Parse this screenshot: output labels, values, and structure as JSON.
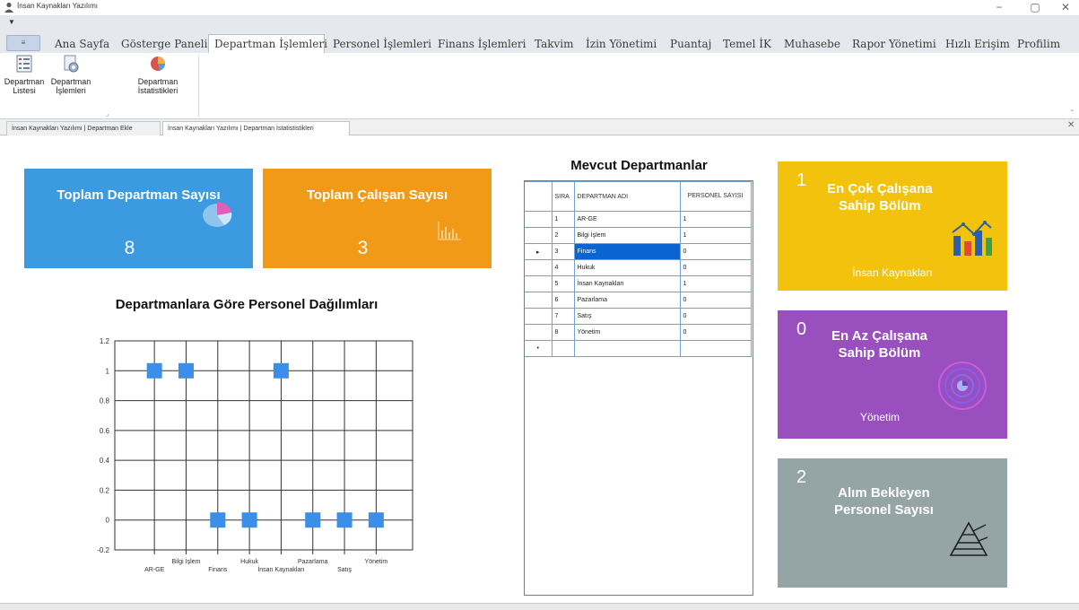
{
  "window": {
    "title": "İnsan Kaynakları Yazılımı",
    "minimize": "−",
    "maximize": "▢",
    "close": "✕"
  },
  "ribbon": {
    "app_button": "≡",
    "tabs": [
      "Ana Sayfa",
      "Gösterge Paneli",
      "Departman İşlemleri",
      "Personel İşlemleri",
      "Finans İşlemleri",
      "Takvim",
      "İzin Yönetimi",
      "Puantaj",
      "Temel İK",
      "Muhasebe",
      "Rapor Yönetimi",
      "Hızlı Erişim",
      "Profilim"
    ],
    "active_tab": "Departman İşlemleri",
    "buttons": [
      {
        "line1": "Departman",
        "line2": "Listesi",
        "icon": "list-icon"
      },
      {
        "line1": "Departman",
        "line2": "İşlemleri",
        "icon": "settings-doc-icon"
      },
      {
        "line1": "Departman",
        "line2": "İstatistikleri",
        "icon": "pie-chart-icon"
      }
    ]
  },
  "doc_tabs": [
    "İnsan Kaynakları Yazılımı | Departman Ekle",
    "İnsan Kaynakları Yazılımı | Departman İstatististikleri"
  ],
  "cards": {
    "dept_count": {
      "title": "Toplam Departman Sayısı",
      "value": "8",
      "color": "#3b9ae0",
      "icon": "pie-chart-icon"
    },
    "emp_count": {
      "title": "Toplam Çalışan Sayısı",
      "value": "3",
      "color": "#f19a18",
      "icon": "bar-chart-icon"
    }
  },
  "chart_title": "Departmanlara Göre Personel Dağılımları",
  "chart_data": {
    "type": "scatter",
    "title": "Departmanlara Göre Personel Dağılımları",
    "categories": [
      "AR-GE",
      "Bilgi İşlem",
      "Finans",
      "Hukuk",
      "İnsan Kaynakları",
      "Pazarlama",
      "Satış",
      "Yönetim"
    ],
    "values": [
      1,
      1,
      0,
      0,
      1,
      0,
      0,
      0
    ],
    "ylim": [
      -0.2,
      1.2
    ],
    "yticks": [
      "1.2",
      "1",
      "0.8",
      "0.6",
      "0.4",
      "0.2",
      "0",
      "-0.2"
    ],
    "grid": true,
    "marker_color": "#3b8fe8"
  },
  "grid": {
    "title": "Mevcut Departmanlar",
    "headers": {
      "sira": "SIRA",
      "name": "DEPARTMAN ADI",
      "count": "PERSONEL SAYISI"
    },
    "rows": [
      {
        "sira": "1",
        "name": "AR-GE",
        "count": "1"
      },
      {
        "sira": "2",
        "name": "Bilgi İşlem",
        "count": "1"
      },
      {
        "sira": "3",
        "name": "Finans",
        "count": "0"
      },
      {
        "sira": "4",
        "name": "Hukuk",
        "count": "0"
      },
      {
        "sira": "5",
        "name": "İnsan Kaynakları",
        "count": "1"
      },
      {
        "sira": "6",
        "name": "Pazarlama",
        "count": "0"
      },
      {
        "sira": "7",
        "name": "Satış",
        "count": "0"
      },
      {
        "sira": "8",
        "name": "Yönetim",
        "count": "0"
      }
    ],
    "selected_row": 2,
    "current_row_marker": "▸",
    "new_row_marker": "•"
  },
  "right_cards": {
    "most": {
      "num": "1",
      "line1": "En Çok Çalışana",
      "line2": "Sahip Bölüm",
      "foot": "İnsan Kaynakları",
      "color": "#f3c20c",
      "icon": "bar-chart-icon"
    },
    "least": {
      "num": "0",
      "line1": "En Az Çalışana",
      "line2": "Sahip Bölüm",
      "foot": "Yönetim",
      "color": "#9a4fbe",
      "icon": "radar-icon"
    },
    "pending": {
      "num": "2",
      "line1": "Alım Bekleyen",
      "line2": "Personel Sayısı",
      "color": "#95a5a6",
      "icon": "pyramid-icon"
    }
  }
}
